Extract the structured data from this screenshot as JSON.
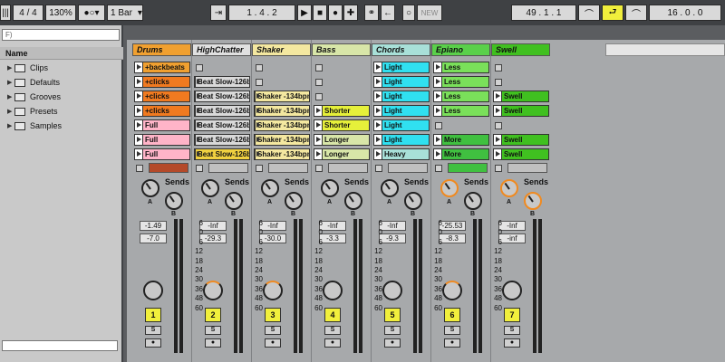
{
  "topbar": {
    "time_sig": "4 / 4",
    "zoom": "130%",
    "quantize": "1 Bar",
    "position": "1 .  4 .  2",
    "new_label": "NEW",
    "loop_start": "49 .  1 .  1",
    "loop_length": "16 .  0 .  0"
  },
  "browser": {
    "search_placeholder": "F)",
    "name_header": "Name",
    "folders": [
      "Clips",
      "Defaults",
      "Grooves",
      "Presets",
      "Samples"
    ]
  },
  "tracks": [
    {
      "name": "Drums",
      "color": "#f0a030",
      "clips": [
        "+backbeats",
        "+clicks",
        "+clicks",
        "+clicks",
        "Full",
        "Full",
        "Full"
      ],
      "clip_colors": [
        "#f0a030",
        "#f07a20",
        "#f07a20",
        "#f07a20",
        "#ffb4c8",
        "#ffb4c8",
        "#ffb4c8"
      ],
      "vol": "-1.49",
      "vol2": "-7.0",
      "number": "1"
    },
    {
      "name": "HighChatter",
      "color": "#e0e0e0",
      "clips": [
        "",
        "Beat Slow-126bp",
        "Beat Slow-126bp",
        "Beat Slow-126bp",
        "Beat Slow-126bp",
        "Beat Slow-126bp",
        "Beat Slow-126bp"
      ],
      "clip_colors": [
        "",
        "#d9d9d9",
        "#d9d9d9",
        "#d9d9d9",
        "#d9d9d9",
        "#d9d9d9",
        "#f0d040"
      ],
      "vol": "-Inf",
      "vol2": "-29.3",
      "number": "2"
    },
    {
      "name": "Shaker",
      "color": "#f4e8a0",
      "clips": [
        "",
        "",
        "Shaker -134bpm",
        "Shaker -134bpm",
        "Shaker -134bpm",
        "Shaker -134bpm",
        "Shaker -134bpm"
      ],
      "clip_colors": [
        "",
        "",
        "#f4e8a0",
        "#f4e8a0",
        "#f4e8a0",
        "#f4e8a0",
        "#f4e8a0"
      ],
      "vol": "-Inf",
      "vol2": "-30.0",
      "number": "3"
    },
    {
      "name": "Bass",
      "color": "#d8e6a8",
      "clips": [
        "",
        "",
        "",
        "Shorter",
        "Shorter",
        "Longer",
        "Longer"
      ],
      "clip_colors": [
        "",
        "",
        "",
        "#e6f03a",
        "#e6f03a",
        "#d8e6a8",
        "#d8e6a8"
      ],
      "vol": "-Inf",
      "vol2": "-3.3",
      "number": "4"
    },
    {
      "name": "Chords",
      "color": "#a8e0d8",
      "clips": [
        "Light",
        "Light",
        "Light",
        "Light",
        "Light",
        "Light",
        "Heavy"
      ],
      "clip_colors": [
        "#30e0f0",
        "#30e0f0",
        "#30e0f0",
        "#30e0f0",
        "#30e0f0",
        "#30e0f0",
        "#a8e0d8"
      ],
      "vol": "-Inf",
      "vol2": "-9.3",
      "number": "5"
    },
    {
      "name": "Epiano",
      "color": "#5ad04a",
      "clips": [
        "Less",
        "Less",
        "Less",
        "Less",
        "",
        "More",
        "More"
      ],
      "clip_colors": [
        "#7ae05a",
        "#7ae05a",
        "#7ae05a",
        "#7ae05a",
        "",
        "#40c040",
        "#40c040"
      ],
      "vol": "-25.53",
      "vol2": "-8.3",
      "number": "6"
    },
    {
      "name": "Swell",
      "color": "#40c020",
      "clips": [
        "",
        "",
        "Swell",
        "Swell",
        "",
        "Swell",
        "Swell"
      ],
      "clip_colors": [
        "",
        "",
        "#40c020",
        "#40c020",
        "",
        "#40c020",
        "#40c020"
      ],
      "vol": "-Inf",
      "vol2": "-inf",
      "number": "7"
    }
  ],
  "mixer": {
    "sends_label": "Sends",
    "knob_a": "A",
    "knob_b": "B",
    "scale": [
      "6",
      "0",
      "6",
      "12",
      "18",
      "24",
      "30",
      "36",
      "48",
      "60"
    ],
    "s_label": "S",
    "rec_label": "●"
  }
}
